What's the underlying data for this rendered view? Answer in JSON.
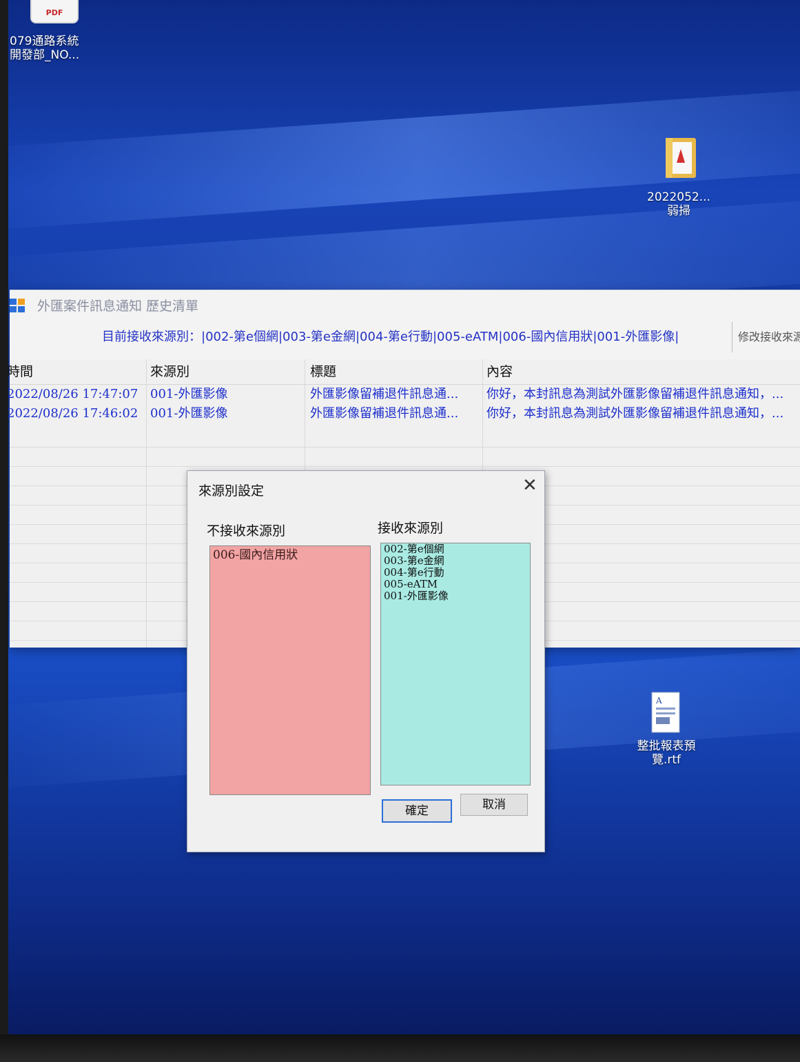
{
  "desktop": {
    "icon_pdf_badge": "PDF",
    "icon_pdf_label_line1": "079通路系統",
    "icon_pdf_label_line2": "開發部_NO...",
    "icon_folder_label_line1": "2022052...",
    "icon_folder_label_line2": "弱掃",
    "icon_rtf_label_line1": "整批報表預",
    "icon_rtf_label_line2": "覽.rtf"
  },
  "window": {
    "title": "外匯案件訊息通知 歷史清單",
    "source_label": "目前接收來源別：|002-第e個網|003-第e金網|004-第e行動|005-eATM|006-國內信用狀|001-外匯影像|",
    "modify_link": "修改接收來源",
    "columns": [
      "時間",
      "來源別",
      "標題",
      "內容"
    ],
    "rows": [
      {
        "time": "2022/08/26 17:47:07",
        "source": "001-外匯影像",
        "title": "外匯影像留補退件訊息通...",
        "content": "你好，本封訊息為測試外匯影像留補退件訊息通知，..."
      },
      {
        "time": "2022/08/26 17:46:02",
        "source": "001-外匯影像",
        "title": "外匯影像留補退件訊息通...",
        "content": "你好，本封訊息為測試外匯影像留補退件訊息通知，..."
      }
    ]
  },
  "dialog": {
    "title": "來源別設定",
    "close_symbol": "✕",
    "not_receive_label": "不接收來源別",
    "receive_label": "接收來源別",
    "not_receive_items": [
      "006-國內信用狀"
    ],
    "receive_items": [
      "002-第e個網",
      "003-第e金網",
      "004-第e行動",
      "005-eATM",
      "001-外匯影像"
    ],
    "ok_label": "確定",
    "cancel_label": "取消"
  },
  "colors": {
    "not_receive_bg": "#f2a3a3",
    "receive_bg": "#a9ebe3",
    "link_blue": "#2432c4",
    "desktop_blue": "#1844b8"
  }
}
